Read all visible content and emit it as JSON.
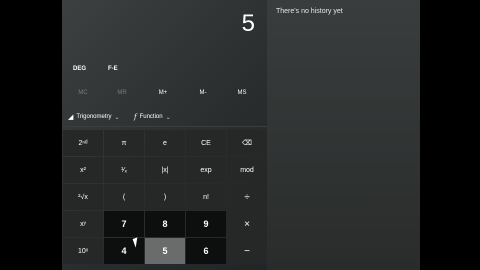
{
  "display": {
    "value": "5"
  },
  "history": {
    "empty_text": "There's no history yet"
  },
  "modes": {
    "angle": "DEG",
    "notation": "F-E"
  },
  "memory": [
    "MC",
    "MR",
    "M+",
    "M-",
    "MS"
  ],
  "menu": {
    "trig_label": "Trigonometry",
    "func_label": "Function",
    "func_glyph": "f"
  },
  "keys": {
    "row1": [
      "2ⁿᵈ",
      "π",
      "e",
      "CE",
      "⌫"
    ],
    "row2": [
      "x²",
      "¹⁄ₓ",
      "|x|",
      "exp",
      "mod"
    ],
    "row3": [
      "²√x",
      "(",
      ")",
      "n!",
      "÷"
    ],
    "row4": [
      "xʸ",
      "7",
      "8",
      "9",
      "×"
    ],
    "row5": [
      "10ˣ",
      "4",
      "5",
      "6",
      "−"
    ]
  }
}
